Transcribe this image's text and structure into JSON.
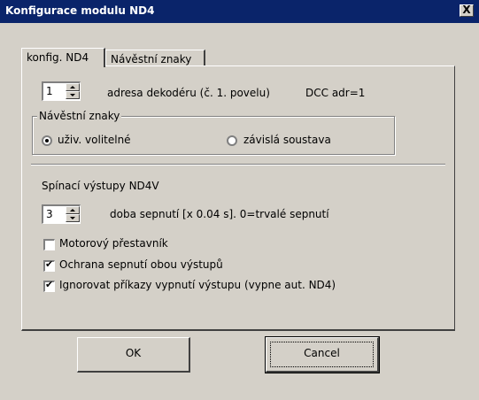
{
  "window": {
    "title": "Konfigurace modulu ND4",
    "close_glyph": "X"
  },
  "tabs": [
    {
      "label": "konfig. ND4",
      "active": true
    },
    {
      "label": "Návěstní znaky",
      "active": false
    }
  ],
  "address": {
    "value": "1",
    "label": "adresa dekodéru (č. 1. povelu)",
    "dcc": "DCC adr=1"
  },
  "signal_group": {
    "legend": "Návěstní znaky",
    "options": [
      {
        "label": "uživ. volitelné",
        "selected": true
      },
      {
        "label": "závislá soustava",
        "selected": false
      }
    ]
  },
  "outputs": {
    "heading": "Spínací výstupy  ND4V",
    "time_value": "3",
    "time_label": "doba sepnutí [x 0.04 s]. 0=trvalé sepnutí",
    "checkboxes": [
      {
        "label": "Motorový přestavník",
        "checked": false
      },
      {
        "label": "Ochrana sepnutí obou výstupů",
        "checked": true
      },
      {
        "label": "Ignorovat příkazy vypnutí výstupu  (vypne aut. ND4)",
        "checked": true
      }
    ]
  },
  "buttons": {
    "ok": "OK",
    "cancel": "Cancel"
  },
  "colors": {
    "titlebar": "#0a246a",
    "face": "#d4d0c8"
  }
}
